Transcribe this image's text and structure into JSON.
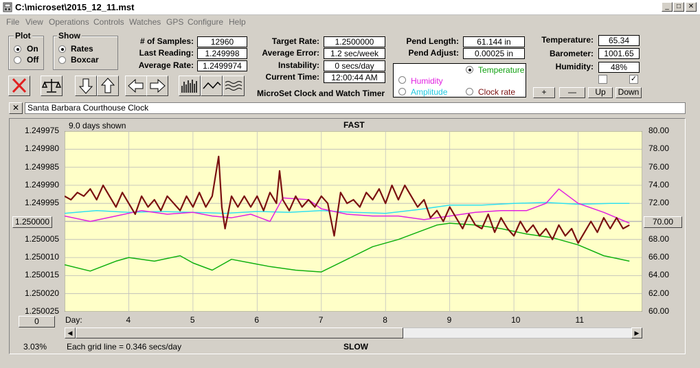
{
  "window": {
    "title": "C:\\microset\\2015_12_11.mst"
  },
  "menu": [
    "File",
    "View",
    "Operations",
    "Controls",
    "Watches",
    "GPS",
    "Configure",
    "Help"
  ],
  "plot": {
    "title": "Plot",
    "on": "On",
    "off": "Off",
    "selected": "On"
  },
  "show": {
    "title": "Show",
    "rates": "Rates",
    "boxcar": "Boxcar",
    "selected": "Rates"
  },
  "stats": {
    "samples_label": "# of Samples:",
    "samples": "12960",
    "last_label": "Last Reading:",
    "last": "1.249998",
    "avg_label": "Average Rate:",
    "avg": "1.2499974"
  },
  "target": {
    "rate_label": "Target Rate:",
    "rate": "1.2500000",
    "err_label": "Average Error:",
    "err": "1.2 sec/week",
    "inst_label": "Instability:",
    "inst": "0 secs/day",
    "time_label": "Current Time:",
    "time": "12:00:44 AM",
    "app_caption": "MicroSet Clock and Watch Timer"
  },
  "pend": {
    "len_label": "Pend Length:",
    "len": "61.144 in",
    "adj_label": "Pend Adjust:",
    "adj": "0.00025 in"
  },
  "overlay": {
    "temperature": "Temperature",
    "humidity": "Humidity",
    "amplitude": "Amplitude",
    "clock_rate": "Clock rate",
    "selected": "Temperature"
  },
  "env": {
    "temp_label": "Temperature:",
    "temp": "65.34",
    "baro_label": "Barometer:",
    "baro": "1001.65",
    "hum_label": "Humidity:",
    "hum": "48%",
    "check1": false,
    "check2": true
  },
  "scale_buttons": {
    "plus": "+",
    "minus": "—",
    "up": "Up",
    "down": "Down"
  },
  "clock_name": "Santa Barbara Courthouse Clock",
  "chart": {
    "days_shown": "9.0 days shown",
    "top_label": "FAST",
    "bottom_label": "SLOW",
    "center_value": "1.250000",
    "right_center": "70.00",
    "left_box": "0",
    "percent": "3.03%",
    "grid_note": "Each grid line = 0.346 secs/day",
    "day_label": "Day:"
  },
  "colors": {
    "plot_bg": "#ffffc8",
    "rate": "#7a1010",
    "temperature": "#10b010",
    "humidity": "#e020e0",
    "amplitude": "#30e0f0",
    "window_bg": "#d4d0c8"
  },
  "chart_data": {
    "type": "line",
    "title": "",
    "y_left": {
      "ticks": [
        "1.249975",
        "1.249980",
        "1.249985",
        "1.249990",
        "1.249995",
        "1.250000",
        "1.250005",
        "1.250010",
        "1.250015",
        "1.250020",
        "1.250025"
      ],
      "ylim": [
        1.249975,
        1.250025
      ],
      "inverted": true
    },
    "y_right": {
      "ticks": [
        "80.00",
        "78.00",
        "76.00",
        "74.00",
        "72.00",
        "70.00",
        "68.00",
        "66.00",
        "64.00",
        "62.00",
        "60.00"
      ],
      "ylim": [
        60,
        80
      ]
    },
    "x": {
      "ticks": [
        "4",
        "5",
        "6",
        "7",
        "8",
        "9",
        "10",
        "11"
      ],
      "xlim": [
        3,
        12
      ]
    },
    "series": [
      {
        "name": "Rate",
        "axis": "left",
        "color": "#7a1010",
        "points": [
          [
            3.0,
            1.249993
          ],
          [
            3.1,
            1.249994
          ],
          [
            3.2,
            1.249992
          ],
          [
            3.3,
            1.249993
          ],
          [
            3.4,
            1.249991
          ],
          [
            3.5,
            1.249994
          ],
          [
            3.6,
            1.24999
          ],
          [
            3.7,
            1.249993
          ],
          [
            3.8,
            1.249996
          ],
          [
            3.9,
            1.249992
          ],
          [
            4.0,
            1.249995
          ],
          [
            4.1,
            1.249998
          ],
          [
            4.2,
            1.249993
          ],
          [
            4.3,
            1.249996
          ],
          [
            4.4,
            1.249994
          ],
          [
            4.5,
            1.249997
          ],
          [
            4.6,
            1.249993
          ],
          [
            4.7,
            1.249995
          ],
          [
            4.8,
            1.249997
          ],
          [
            4.9,
            1.249993
          ],
          [
            5.0,
            1.249996
          ],
          [
            5.1,
            1.249992
          ],
          [
            5.2,
            1.249996
          ],
          [
            5.3,
            1.249993
          ],
          [
            5.4,
            1.249982
          ],
          [
            5.45,
            1.249996
          ],
          [
            5.5,
            1.250002
          ],
          [
            5.6,
            1.249993
          ],
          [
            5.7,
            1.249996
          ],
          [
            5.8,
            1.249993
          ],
          [
            5.9,
            1.249996
          ],
          [
            6.0,
            1.249993
          ],
          [
            6.1,
            1.249997
          ],
          [
            6.2,
            1.249992
          ],
          [
            6.3,
            1.249995
          ],
          [
            6.35,
            1.249986
          ],
          [
            6.4,
            1.249994
          ],
          [
            6.5,
            1.249997
          ],
          [
            6.6,
            1.249993
          ],
          [
            6.7,
            1.249996
          ],
          [
            6.8,
            1.249994
          ],
          [
            6.9,
            1.249996
          ],
          [
            7.0,
            1.249993
          ],
          [
            7.1,
            1.249995
          ],
          [
            7.2,
            1.250004
          ],
          [
            7.3,
            1.249992
          ],
          [
            7.4,
            1.249995
          ],
          [
            7.5,
            1.249994
          ],
          [
            7.6,
            1.249996
          ],
          [
            7.7,
            1.249992
          ],
          [
            7.8,
            1.249994
          ],
          [
            7.9,
            1.249991
          ],
          [
            8.0,
            1.249995
          ],
          [
            8.1,
            1.24999
          ],
          [
            8.2,
            1.249994
          ],
          [
            8.3,
            1.24999
          ],
          [
            8.4,
            1.249993
          ],
          [
            8.5,
            1.249996
          ],
          [
            8.6,
            1.249994
          ],
          [
            8.7,
            1.249999
          ],
          [
            8.8,
            1.249997
          ],
          [
            8.9,
            1.25
          ],
          [
            9.0,
            1.249996
          ],
          [
            9.1,
            1.249999
          ],
          [
            9.2,
            1.250002
          ],
          [
            9.3,
            1.249998
          ],
          [
            9.4,
            1.250001
          ],
          [
            9.5,
            1.250002
          ],
          [
            9.6,
            1.249998
          ],
          [
            9.7,
            1.250003
          ],
          [
            9.8,
            1.249999
          ],
          [
            9.9,
            1.250002
          ],
          [
            10.0,
            1.250004
          ],
          [
            10.1,
            1.25
          ],
          [
            10.2,
            1.250003
          ],
          [
            10.3,
            1.250001
          ],
          [
            10.4,
            1.250004
          ],
          [
            10.5,
            1.250002
          ],
          [
            10.6,
            1.250005
          ],
          [
            10.7,
            1.250001
          ],
          [
            10.8,
            1.250004
          ],
          [
            10.9,
            1.250002
          ],
          [
            11.0,
            1.250006
          ],
          [
            11.1,
            1.250003
          ],
          [
            11.2,
            1.25
          ],
          [
            11.3,
            1.250003
          ],
          [
            11.4,
            1.249999
          ],
          [
            11.5,
            1.250002
          ],
          [
            11.6,
            1.249999
          ],
          [
            11.7,
            1.250002
          ],
          [
            11.8,
            1.250001
          ]
        ]
      },
      {
        "name": "Temperature",
        "axis": "right",
        "color": "#10b010",
        "points": [
          [
            3.0,
            65.2
          ],
          [
            3.4,
            64.5
          ],
          [
            3.8,
            65.6
          ],
          [
            4.0,
            66.0
          ],
          [
            4.4,
            65.6
          ],
          [
            4.8,
            66.2
          ],
          [
            5.0,
            65.4
          ],
          [
            5.3,
            64.6
          ],
          [
            5.6,
            65.8
          ],
          [
            5.9,
            65.4
          ],
          [
            6.2,
            65.0
          ],
          [
            6.6,
            64.6
          ],
          [
            7.0,
            64.4
          ],
          [
            7.4,
            65.8
          ],
          [
            7.8,
            67.2
          ],
          [
            8.2,
            68.0
          ],
          [
            8.5,
            68.8
          ],
          [
            8.8,
            69.6
          ],
          [
            9.0,
            69.8
          ],
          [
            9.4,
            69.6
          ],
          [
            9.8,
            69.2
          ],
          [
            10.2,
            68.6
          ],
          [
            10.6,
            68.2
          ],
          [
            11.0,
            67.4
          ],
          [
            11.4,
            66.2
          ],
          [
            11.6,
            65.9
          ],
          [
            11.8,
            65.6
          ]
        ]
      },
      {
        "name": "Humidity",
        "axis": "right",
        "color": "#e020e0",
        "points": [
          [
            3.0,
            70.6
          ],
          [
            3.4,
            70.0
          ],
          [
            3.8,
            70.6
          ],
          [
            4.2,
            71.2
          ],
          [
            4.6,
            70.8
          ],
          [
            5.0,
            71.0
          ],
          [
            5.3,
            70.6
          ],
          [
            5.6,
            70.4
          ],
          [
            5.9,
            70.8
          ],
          [
            6.2,
            70.0
          ],
          [
            6.4,
            72.6
          ],
          [
            6.8,
            72.4
          ],
          [
            7.0,
            71.4
          ],
          [
            7.4,
            70.8
          ],
          [
            7.8,
            70.6
          ],
          [
            8.2,
            70.6
          ],
          [
            8.6,
            70.2
          ],
          [
            9.0,
            70.6
          ],
          [
            9.4,
            71.0
          ],
          [
            9.8,
            71.2
          ],
          [
            10.2,
            71.2
          ],
          [
            10.5,
            72.0
          ],
          [
            10.7,
            73.6
          ],
          [
            11.0,
            72.0
          ],
          [
            11.4,
            71.0
          ],
          [
            11.8,
            69.8
          ]
        ]
      },
      {
        "name": "Amplitude",
        "axis": "right",
        "color": "#30e0f0",
        "points": [
          [
            3.0,
            70.9
          ],
          [
            3.5,
            71.2
          ],
          [
            4.0,
            71.0
          ],
          [
            4.5,
            71.1
          ],
          [
            5.0,
            71.0
          ],
          [
            5.5,
            70.9
          ],
          [
            6.0,
            71.1
          ],
          [
            6.5,
            71.0
          ],
          [
            7.0,
            71.2
          ],
          [
            7.5,
            71.0
          ],
          [
            8.0,
            70.9
          ],
          [
            8.5,
            71.3
          ],
          [
            9.0,
            71.8
          ],
          [
            9.5,
            71.8
          ],
          [
            10.0,
            72.0
          ],
          [
            10.5,
            72.1
          ],
          [
            11.0,
            71.9
          ],
          [
            11.5,
            72.0
          ],
          [
            11.8,
            72.0
          ]
        ]
      }
    ]
  }
}
